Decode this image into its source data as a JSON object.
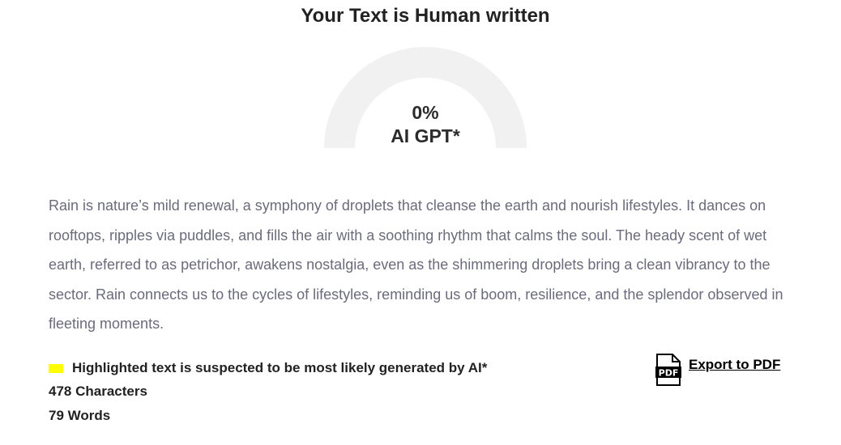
{
  "result": {
    "title": "Your Text is Human written",
    "gauge_percent_text": "0%",
    "gauge_label": "AI GPT*",
    "ai_fraction": 0
  },
  "analyzed_text": "Rain is nature’s mild renewal, a symphony of droplets that cleanse the earth and nourish lifestyles. It dances on rooftops, ripples via puddles, and fills the air with a soothing rhythm that calms the soul. The heady scent of wet earth, referred to as petrichor, awakens nostalgia, even as the shimmering droplets bring a clean vibrancy to the sector. Rain connects us to the cycles of lifestyles, reminding us of boom, resilience, and the splendor observed in fleeting moments.",
  "legend": {
    "text": "Highlighted text is suspected to be most likely generated by AI*",
    "swatch_color": "#ffff00"
  },
  "stats": {
    "characters": "478 Characters",
    "words": "79 Words"
  },
  "export": {
    "label": "Export to PDF",
    "icon": "pdf-file-icon",
    "icon_text": "PDF"
  },
  "colors": {
    "gauge_track": "#f1f1f1",
    "body_text": "#6b6b7b",
    "highlight": "#ffff00"
  }
}
